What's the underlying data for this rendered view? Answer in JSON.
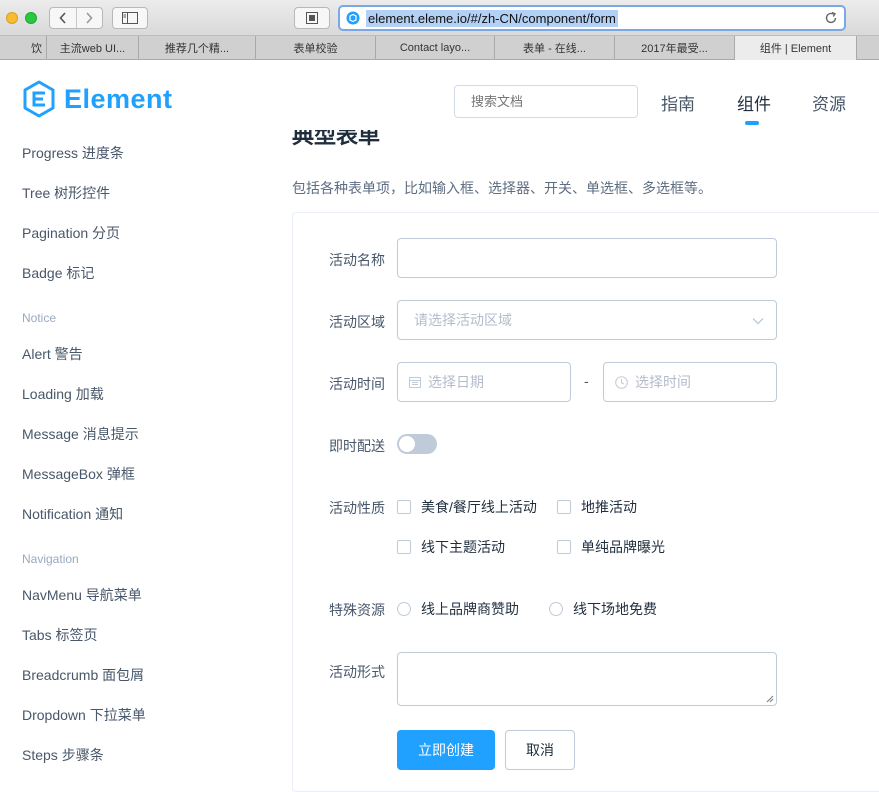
{
  "browser": {
    "url": "element.eleme.io/#/zh-CN/component/form",
    "tabs": [
      "饮",
      "主流web UI...",
      "推荐几个精...",
      "表单校验",
      "Contact layo...",
      "表单 - 在线...",
      "2017年最受...",
      "组件 | Element"
    ]
  },
  "site": {
    "logo_text": "Element",
    "search_placeholder": "搜索文档",
    "nav": [
      "指南",
      "组件",
      "资源"
    ],
    "brand_color": "#20a0ff"
  },
  "sidebar": {
    "items_top": [
      "Progress 进度条",
      "Tree 树形控件",
      "Pagination 分页",
      "Badge 标记"
    ],
    "group_notice": "Notice",
    "items_notice": [
      "Alert 警告",
      "Loading 加载",
      "Message 消息提示",
      "MessageBox 弹框",
      "Notification 通知"
    ],
    "group_navigation": "Navigation",
    "items_navigation": [
      "NavMenu 导航菜单",
      "Tabs 标签页",
      "Breadcrumb 面包屑",
      "Dropdown 下拉菜单",
      "Steps 步骤条"
    ]
  },
  "main": {
    "section_title": "典型表单",
    "description": "包括各种表单项，比如输入框、选择器、开关、单选框、多选框等。",
    "form": {
      "name_label": "活动名称",
      "region_label": "活动区域",
      "region_placeholder": "请选择活动区域",
      "time_label": "活动时间",
      "date_placeholder": "选择日期",
      "time_separator": "-",
      "time_placeholder": "选择时间",
      "delivery_label": "即时配送",
      "type_label": "活动性质",
      "type_options": [
        "美食/餐厅线上活动",
        "地推活动",
        "线下主题活动",
        "单纯品牌曝光"
      ],
      "resource_label": "特殊资源",
      "resource_options": [
        "线上品牌商赞助",
        "线下场地免费"
      ],
      "desc_label": "活动形式",
      "submit_label": "立即创建",
      "cancel_label": "取消"
    }
  }
}
